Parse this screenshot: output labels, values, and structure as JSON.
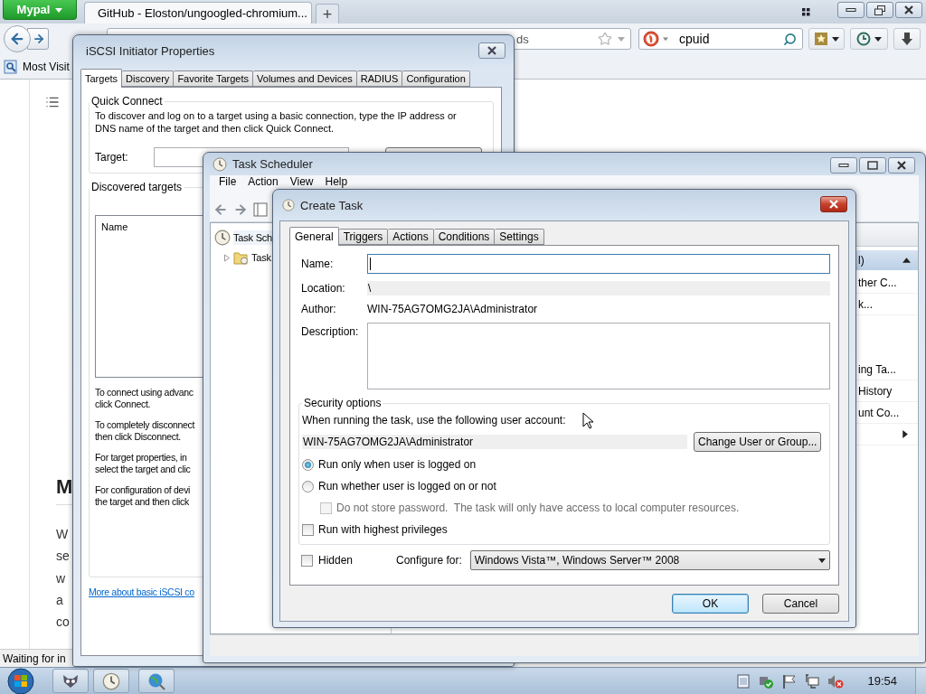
{
  "browser": {
    "menu_button": "Mypal",
    "tabs": [
      {
        "title": "GitHub - Eloston/ungoogled-chromium...",
        "selected": true
      }
    ],
    "new_tab": "+",
    "address": {
      "placeholder": "ds"
    },
    "search": {
      "value": "cpuid"
    },
    "bookmarks": [
      "Most Visit"
    ],
    "page": {
      "heading": "M",
      "line_fragments": [
        "W",
        "se",
        "w",
        "a",
        "co"
      ]
    },
    "status": "Waiting for in"
  },
  "iscsi": {
    "title": "iSCSI Initiator Properties",
    "tabs": [
      {
        "label": "Targets",
        "selected": true
      },
      {
        "label": "Discovery",
        "selected": false
      },
      {
        "label": "Favorite Targets",
        "selected": false
      },
      {
        "label": "Volumes and Devices",
        "selected": false
      },
      {
        "label": "RADIUS",
        "selected": false
      },
      {
        "label": "Configuration",
        "selected": false
      }
    ],
    "quick_connect": {
      "title": "Quick Connect",
      "text_lines": [
        "To discover and log on to a target using a basic connection, type the IP address or",
        "DNS name of the target and then click Quick Connect."
      ],
      "target_label": "Target:"
    },
    "discovered": {
      "title": "Discovered targets",
      "columns": [
        "Name"
      ],
      "help_paragraphs": [
        [
          "To connect using advanc",
          "click Connect."
        ],
        [
          "To completely disconnect",
          "then click Disconnect."
        ],
        [
          "For target properties, in",
          "select the target and clic"
        ],
        [
          "For configuration of devi",
          "the target and then click"
        ]
      ]
    },
    "link": "More about basic iSCSI co"
  },
  "task_scheduler": {
    "title": "Task Scheduler",
    "menu": [
      "File",
      "Action",
      "View",
      "Help"
    ],
    "tree": [
      {
        "label": "Task Sch",
        "children": [
          {
            "label": "Task",
            "expanded": false
          }
        ]
      }
    ],
    "actions": {
      "header": "l)",
      "groups": [
        [
          "ther C...",
          "k..."
        ],
        [
          "ing Ta...",
          "History",
          "unt Co..."
        ]
      ]
    }
  },
  "create_task": {
    "title": "Create Task",
    "tabs": [
      {
        "label": "General",
        "selected": true
      },
      {
        "label": "Triggers",
        "selected": false
      },
      {
        "label": "Actions",
        "selected": false
      },
      {
        "label": "Conditions",
        "selected": false
      },
      {
        "label": "Settings",
        "selected": false
      }
    ],
    "fields": [
      {
        "kind": "input",
        "label": "Name:",
        "focused": true
      },
      {
        "kind": "readonly",
        "label": "Location:",
        "value": "\\"
      },
      {
        "kind": "text",
        "label": "Author:",
        "value": "WIN-75AG7OMG2JA\\Administrator"
      },
      {
        "kind": "textarea",
        "label": "Description:",
        "focused": false
      }
    ],
    "security": {
      "title": "Security options",
      "account_prompt": "When running the task, use the following user account:",
      "account": "WIN-75AG7OMG2JA\\Administrator",
      "change_button": "Change User or Group...",
      "options": [
        {
          "kind": "radio",
          "label": "Run only when user is logged on",
          "selected": true
        },
        {
          "kind": "radio",
          "label": "Run whether user is logged on or not",
          "selected": false,
          "children": [
            {
              "kind": "checkbox",
              "label": "Do not store password.  The task will only have access to local computer resources.",
              "checked": false,
              "disabled": true
            }
          ]
        },
        {
          "kind": "checkbox",
          "label": "Run with highest privileges",
          "checked": false,
          "disabled": false
        }
      ]
    },
    "hidden": {
      "label": "Hidden",
      "checked": false
    },
    "configure": {
      "label": "Configure for:",
      "value": "Windows Vista™, Windows Server™ 2008"
    },
    "buttons": [
      {
        "label": "OK",
        "default": true
      },
      {
        "label": "Cancel",
        "default": false
      }
    ]
  },
  "taskbar": {
    "clock": "19:54"
  }
}
